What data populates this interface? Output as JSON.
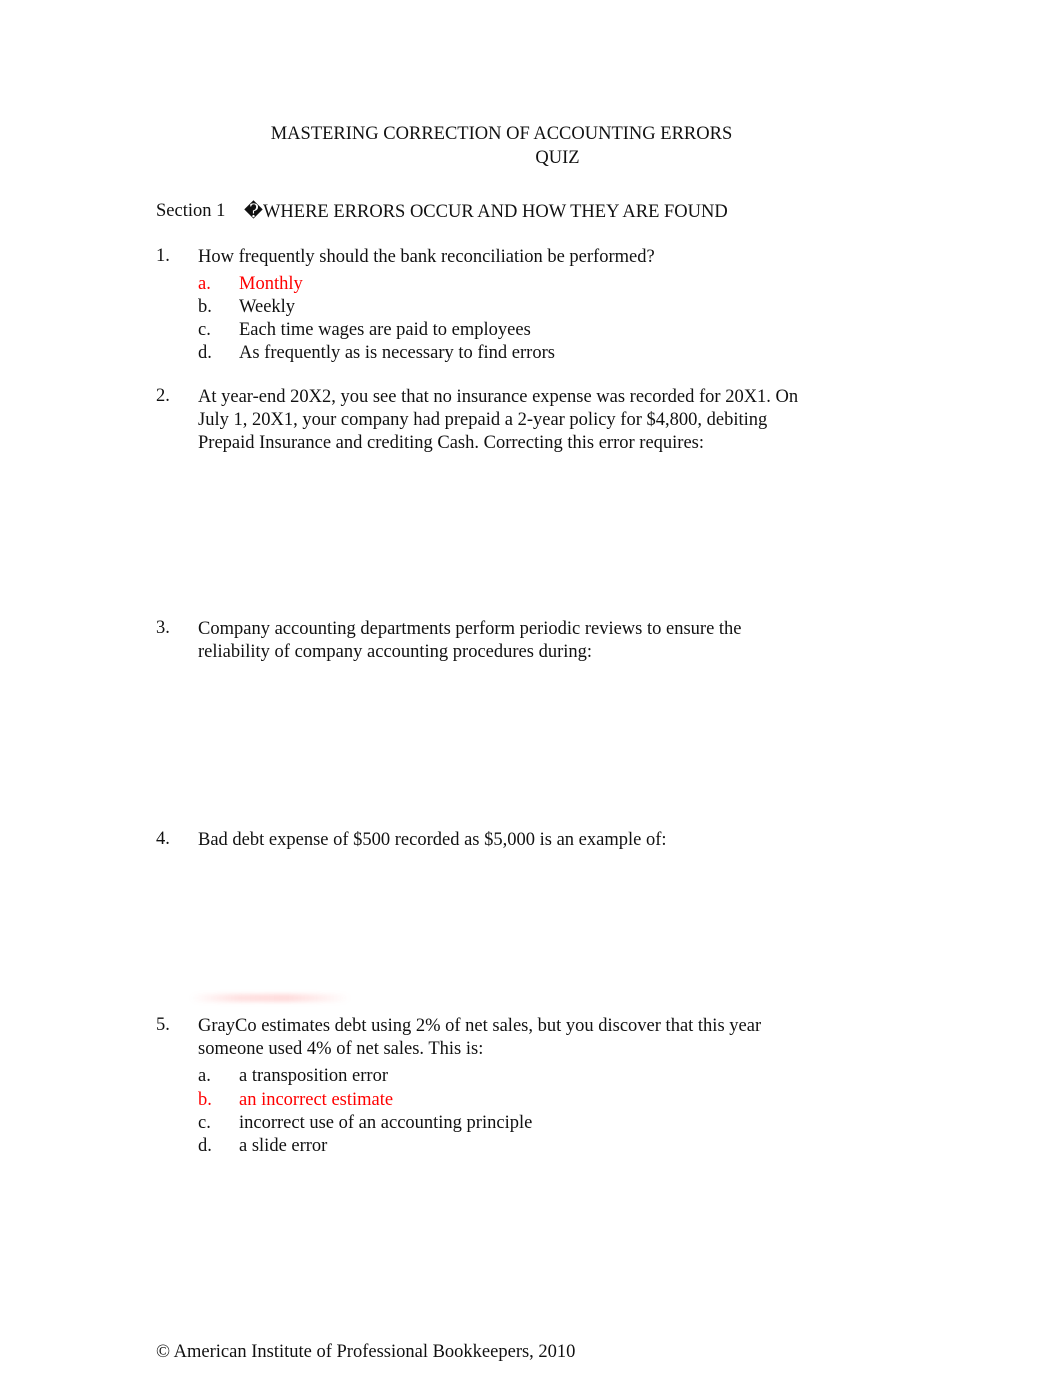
{
  "document": {
    "title_line1": "MASTERING CORRECTION OF ACCOUNTING ERRORS",
    "title_line2": "QUIZ",
    "section_label": "Section 1",
    "section_title": "�WHERE ERRORS OCCUR AND HOW THEY ARE FOUND",
    "accent_color": "#ff0000",
    "questions": [
      {
        "number": "1.",
        "text": "How frequently should the bank reconciliation be performed?",
        "options": [
          {
            "letter": "a.",
            "text": "Monthly",
            "highlighted": true
          },
          {
            "letter": "b.",
            "text": "Weekly",
            "highlighted": false
          },
          {
            "letter": "c.",
            "text": "Each time wages are paid to employees",
            "highlighted": false
          },
          {
            "letter": "d.",
            "text": "As frequently as is necessary to find errors",
            "highlighted": false
          }
        ]
      },
      {
        "number": "2.",
        "text": "At year-end 20X2, you see that no insurance expense was recorded for 20X1. On July 1, 20X1, your company had prepaid a 2-year policy for $4,800, debiting Prepaid Insurance and crediting Cash. Correcting this error requires:",
        "options": []
      },
      {
        "number": "3.",
        "text": "Company accounting departments perform periodic reviews to ensure the reliability of company accounting procedures during:",
        "options": []
      },
      {
        "number": "4.",
        "text": "Bad debt expense of $500 recorded as $5,000 is an example of:",
        "options": []
      },
      {
        "number": "5.",
        "text": "GrayCo estimates debt using 2% of net sales, but you discover that this year someone used 4% of net sales. This is:",
        "options": [
          {
            "letter": "a.",
            "text": "a transposition error",
            "highlighted": false
          },
          {
            "letter": "b.",
            "text": "an incorrect estimate",
            "highlighted": true
          },
          {
            "letter": "c.",
            "text": "incorrect use of an accounting principle",
            "highlighted": false
          },
          {
            "letter": "d.",
            "text": "a slide error",
            "highlighted": false
          }
        ]
      }
    ],
    "footer": "© American Institute of Professional Bookkeepers, 2010"
  }
}
